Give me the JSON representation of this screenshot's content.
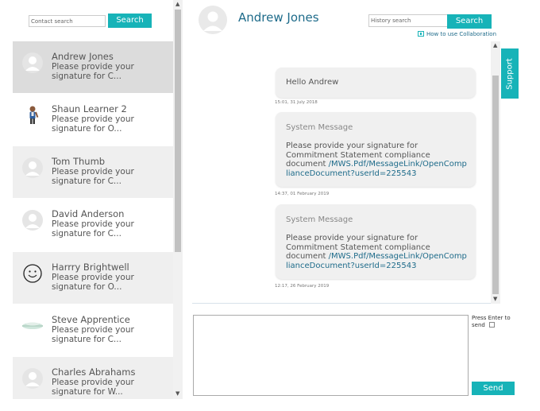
{
  "contacts_panel": {
    "search_placeholder": "Contact search",
    "search_button": "Search",
    "contacts": [
      {
        "name": "Andrew Jones",
        "snippet": "Please provide your signature for C...",
        "avatar": "default-avatar",
        "selected": true
      },
      {
        "name": "Shaun Learner 2",
        "snippet": "Please provide your signature for O...",
        "avatar": "person-figure-avatar"
      },
      {
        "name": "Tom Thumb",
        "snippet": "Please provide your signature for C...",
        "avatar": "default-avatar"
      },
      {
        "name": "David Anderson",
        "snippet": "Please provide your signature for C...",
        "avatar": "default-avatar"
      },
      {
        "name": "Harrry Brightwell",
        "snippet": "Please provide your signature for O...",
        "avatar": "smiley-face-avatar"
      },
      {
        "name": "Steve Apprentice",
        "snippet": "Please provide your signature for C...",
        "avatar": "landscape-avatar"
      },
      {
        "name": "Charles Abrahams",
        "snippet": "Please provide your signature for W...",
        "avatar": "default-avatar"
      }
    ]
  },
  "conversation": {
    "contact_name": "Andrew Jones",
    "history_search_placeholder": "History search",
    "history_search_button": "Search",
    "help_link": "How to use Collaboration",
    "support_tab": "Support",
    "messages": [
      {
        "text": "Hello Andrew",
        "timestamp": "15:01, 31 July 2018"
      },
      {
        "label": "System Message",
        "text": "Please provide your signature for Commitment Statement compliance document",
        "link": "/MWS.Pdf/MessageLink/OpenComplianceDocument?userId=225543",
        "timestamp": "14:37, 01 February 2019"
      },
      {
        "label": "System Message",
        "text": "Please provide your signature for Commitment Statement compliance document",
        "link": "/MWS.Pdf/MessageLink/OpenComplianceDocument?userId=225543",
        "timestamp": "12:17, 26 February 2019"
      }
    ],
    "compose": {
      "value": "",
      "press_enter_label": "Press Enter to send",
      "send_button": "Send"
    }
  },
  "colors": {
    "accent": "#17b3b8",
    "name_blue": "#1e6b8a",
    "selected_row": "#dcdcdc",
    "alt_row": "#efefef"
  }
}
